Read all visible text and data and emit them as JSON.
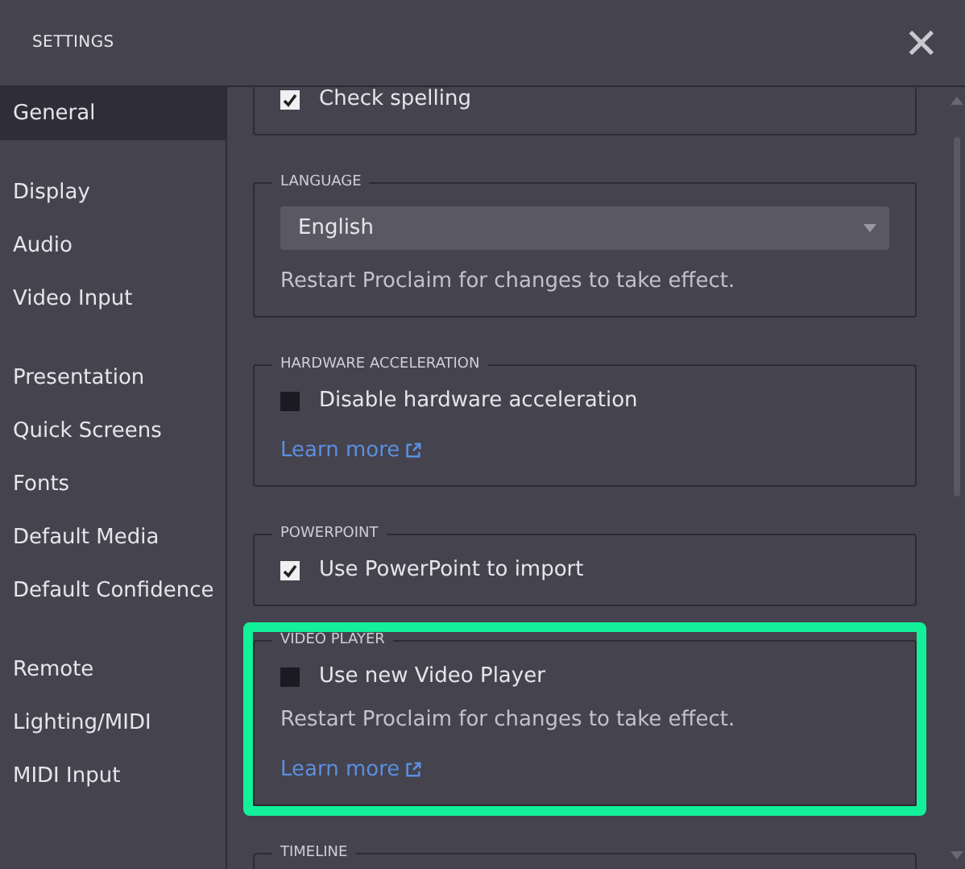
{
  "window": {
    "title": "SETTINGS",
    "close_glyph": "✕"
  },
  "sidebar": {
    "groups": [
      {
        "items": [
          {
            "label": "General",
            "selected": true
          }
        ]
      },
      {
        "items": [
          {
            "label": "Display",
            "selected": false
          },
          {
            "label": "Audio",
            "selected": false
          },
          {
            "label": "Video Input",
            "selected": false
          }
        ]
      },
      {
        "items": [
          {
            "label": "Presentation",
            "selected": false
          },
          {
            "label": "Quick Screens",
            "selected": false
          },
          {
            "label": "Fonts",
            "selected": false
          },
          {
            "label": "Default Media",
            "selected": false
          },
          {
            "label": "Default Confidence",
            "selected": false
          }
        ]
      },
      {
        "items": [
          {
            "label": "Remote",
            "selected": false
          },
          {
            "label": "Lighting/MIDI",
            "selected": false
          },
          {
            "label": "MIDI Input",
            "selected": false
          }
        ]
      }
    ]
  },
  "sections": [
    {
      "highlighted": false,
      "rows": [
        {
          "kind": "checkbox",
          "label": "Check spelling",
          "checked": true
        }
      ]
    },
    {
      "title": "LANGUAGE",
      "highlighted": false,
      "rows": [
        {
          "kind": "dropdown",
          "value": "English"
        },
        {
          "kind": "note",
          "text": "Restart Proclaim for changes to take effect."
        }
      ]
    },
    {
      "title": "HARDWARE ACCELERATION",
      "highlighted": false,
      "rows": [
        {
          "kind": "checkbox",
          "label": "Disable hardware acceleration",
          "checked": false
        },
        {
          "kind": "link",
          "text": "Learn more"
        }
      ]
    },
    {
      "title": "POWERPOINT",
      "highlighted": false,
      "rows": [
        {
          "kind": "checkbox",
          "label": "Use PowerPoint to import",
          "checked": true
        }
      ]
    },
    {
      "title": "VIDEO PLAYER",
      "highlighted": true,
      "rows": [
        {
          "kind": "checkbox",
          "label": "Use new Video Player",
          "checked": false
        },
        {
          "kind": "note",
          "text": "Restart Proclaim for changes to take effect."
        },
        {
          "kind": "link",
          "text": "Learn more"
        }
      ]
    },
    {
      "title": "TIMELINE",
      "highlighted": false
    }
  ]
}
